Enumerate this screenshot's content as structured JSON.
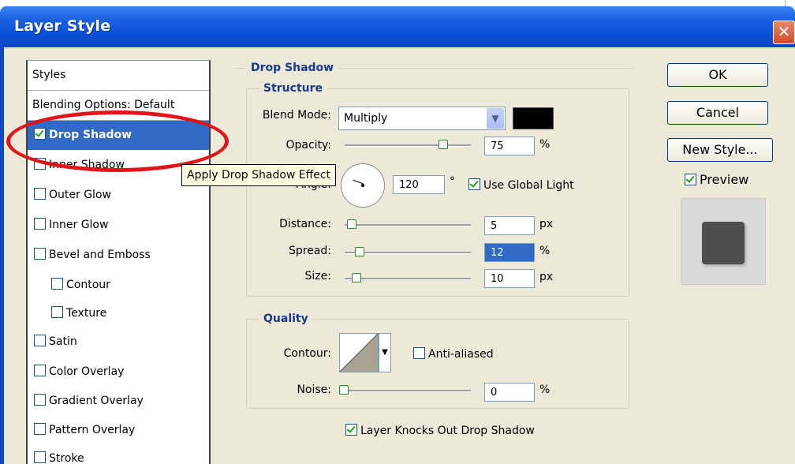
{
  "window": {
    "title": "Layer Style",
    "close_glyph": "✕"
  },
  "styles_panel": {
    "header": "Styles",
    "blending": "Blending Options: Default",
    "items": [
      {
        "label": "Drop Shadow",
        "checked": true,
        "selected": true
      },
      {
        "label": "Inner Shadow",
        "checked": false
      },
      {
        "label": "Outer Glow",
        "checked": false
      },
      {
        "label": "Inner Glow",
        "checked": false
      },
      {
        "label": "Bevel and Emboss",
        "checked": false
      },
      {
        "label": "Contour",
        "checked": false,
        "indent": true
      },
      {
        "label": "Texture",
        "checked": false,
        "indent": true
      },
      {
        "label": "Satin",
        "checked": false
      },
      {
        "label": "Color Overlay",
        "checked": false
      },
      {
        "label": "Gradient Overlay",
        "checked": false
      },
      {
        "label": "Pattern Overlay",
        "checked": false
      },
      {
        "label": "Stroke",
        "checked": false
      }
    ]
  },
  "tooltip": "Apply Drop Shadow Effect",
  "drop_shadow": {
    "title": "Drop Shadow",
    "structure": {
      "title": "Structure",
      "blend_mode_label": "Blend Mode:",
      "blend_mode_value": "Multiply",
      "color": "#000000",
      "opacity_label": "Opacity:",
      "opacity_value": "75",
      "opacity_unit": "%",
      "opacity_level": 0.75,
      "angle_label": "Angle:",
      "angle_value": "120",
      "angle_unit": "°",
      "use_global_light": "Use Global Light",
      "distance_label": "Distance:",
      "distance_value": "5",
      "distance_unit": "px",
      "spread_label": "Spread:",
      "spread_value": "12",
      "spread_unit": "%",
      "size_label": "Size:",
      "size_value": "10",
      "size_unit": "px"
    },
    "quality": {
      "title": "Quality",
      "contour_label": "Contour:",
      "anti_aliased": "Anti-aliased",
      "noise_label": "Noise:",
      "noise_value": "0",
      "noise_unit": "%",
      "knocks_out": "Layer Knocks Out Drop Shadow"
    }
  },
  "buttons": {
    "ok": "OK",
    "cancel": "Cancel",
    "new_style": "New Style..."
  },
  "preview": {
    "label": "Preview",
    "checked": true
  }
}
